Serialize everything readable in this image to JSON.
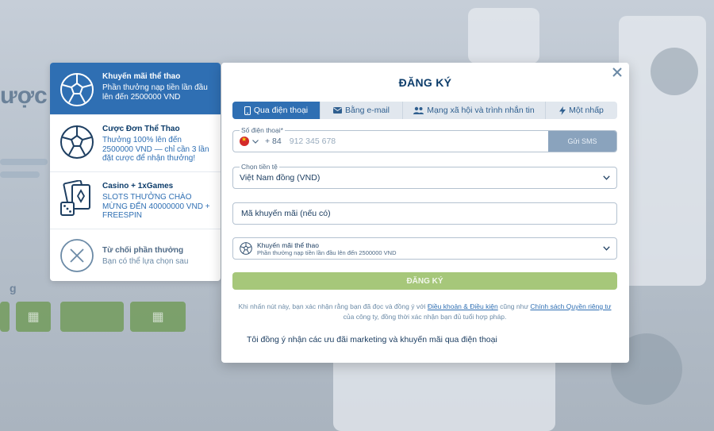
{
  "background": {
    "heading": "ược t",
    "question_mark": "g"
  },
  "bonus_panel": {
    "items": [
      {
        "title": "Khuyến mãi thể thao",
        "desc": "Phần thưởng nạp tiền lần đầu lên đến 2500000 VND",
        "icon": "soccer-ball-icon",
        "active": true
      },
      {
        "title": "Cược Đơn Thể Thao",
        "desc": "Thưởng 100% lên đến 2500000 VND — chỉ cần 3 lần đặt cược để nhận thưởng!",
        "icon": "soccer-ball-icon",
        "active": false
      },
      {
        "title": "Casino + 1xGames",
        "desc": "SLOTS THƯỞNG CHÀO MỪNG ĐẾN 40000000 VND + FREESPIN",
        "icon": "cards-dice-icon",
        "active": false
      },
      {
        "title": "Từ chối phần thưởng",
        "desc": "Bạn có thể lựa chọn sau",
        "icon": "decline-x-icon",
        "active": false
      }
    ]
  },
  "modal": {
    "title": "ĐĂNG KÝ",
    "tabs": [
      {
        "label": "Qua điện thoại",
        "icon": "phone-icon",
        "active": true
      },
      {
        "label": "Bằng e-mail",
        "icon": "envelope-icon",
        "active": false
      },
      {
        "label": "Mạng xã hội và trình nhắn tin",
        "icon": "people-icon",
        "active": false
      },
      {
        "label": "Một nhấp",
        "icon": "lightning-icon",
        "active": false
      }
    ],
    "phone": {
      "label": "Số điện thoại*",
      "country_code": "+ 84",
      "placeholder": "912 345 678",
      "sms_button": "Gửi SMS"
    },
    "currency": {
      "label": "Chọn tiền tệ",
      "value": "Việt Nam đồng (VND)"
    },
    "promo": {
      "placeholder": "Mã khuyến mãi (nếu có)"
    },
    "bonus_select": {
      "title": "Khuyến mãi thể thao",
      "desc": "Phần thưởng nạp tiền lần đầu lên đến 2500000 VND"
    },
    "submit_label": "ĐĂNG KÝ",
    "terms": {
      "before": "Khi nhấn nút này, bạn xác nhận rằng bạn đã đọc và đồng ý với ",
      "link1": "Điều khoản & Điều kiện",
      "middle": " cũng như ",
      "link2": "Chính sách Quyền riêng tư",
      "after": " của công ty, đồng thời xác nhận bạn đủ tuổi hợp pháp."
    },
    "consent_label": "Tôi đồng ý nhận các ưu đãi marketing và khuyến mãi qua điện thoại"
  },
  "colors": {
    "accent": "#2f6fb3",
    "title": "#0d3d6b",
    "submit": "#a6c77a",
    "sms_button": "#8aa3bd"
  }
}
